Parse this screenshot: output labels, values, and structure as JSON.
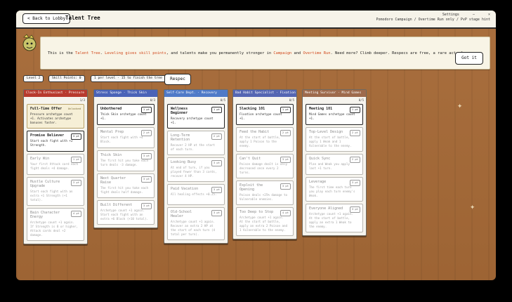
{
  "header": {
    "back_label": "< Back to Lobby",
    "title": "Talent Tree",
    "settings_label": "Settings",
    "minimize": "–",
    "close": "×",
    "breadcrumb": "Pomodoro Campaign / Overtime Run only / PvP stage hint"
  },
  "banner": {
    "p1": "This is the ",
    "h1": "Talent Tree",
    "p2": ". ",
    "h2": "Leveling gives skill points",
    "p3": ", and talents make you permanently stronger in ",
    "h3": "Campaign",
    "p4": " and ",
    "h4": "Overtime Run",
    "p5": ". Need more? Climb deeper. Respecs are free, a rare act of mercy.",
    "button": "Got it"
  },
  "stats": {
    "level": "Level 2",
    "points": "Skill Points: 0",
    "hint": "1 per level · 15 to finish the tree",
    "respec": "Respec"
  },
  "colors": {
    "col1": "#b83a2e",
    "col2": "#4a63b8",
    "col3": "#4f7ac8",
    "col4": "#5566b3",
    "col5": "#9e6a4c"
  },
  "columns": [
    {
      "title": "Clock-In Enthusiast · Pressure",
      "count": "1/3",
      "cards": [
        {
          "name": "Full-Time Offer",
          "desc": "Pressure archetype count +1. Activates archetype bonuses faster.",
          "tag": "Unlocked"
        },
        {
          "name": "Promise Believer",
          "desc": "Start each fight with +2 Strength.",
          "cost": "3 pt"
        },
        {
          "name": "Early Win",
          "desc": "Your first Attack card each fight deals +4 damage.",
          "cost": "1 pt"
        },
        {
          "name": "Hustle Culture Upgrade",
          "desc": "Start each fight with an extra +1 Strength (+1 total).",
          "cost": "3 pt"
        },
        {
          "name": "Bain Character Energy",
          "desc": "Archetype count +1 again. If Strength is 8 or higher, Attack cards deal +2 damage.",
          "cost": "4 pt"
        }
      ]
    },
    {
      "title": "Stress Sponge · Thick Skin",
      "count": "0/3",
      "cards": [
        {
          "name": "Unbothered",
          "desc": "Thick Skin archetype count +1.",
          "cost": "1 pt"
        },
        {
          "name": "Mental Prep",
          "desc": "Start each fight with +4 Block.",
          "cost": "2 pt"
        },
        {
          "name": "Thick Skin",
          "desc": "The first hit you take each turn deals -3 damage.",
          "cost": "3 pt"
        },
        {
          "name": "Next Quarter Raise",
          "desc": "The first hit you take each fight deals half damage.",
          "cost": "3 pt"
        },
        {
          "name": "Built Different",
          "desc": "Archetype count +1 again. Start each fight with an extra +6 Block (+10 total).",
          "cost": "3 pt"
        }
      ]
    },
    {
      "title": "Self-Care Dept. · Recovery",
      "count": "0/5",
      "cards": [
        {
          "name": "Wellness Beginner",
          "desc": "Recovery archetype count +1.",
          "cost": "1 pt"
        },
        {
          "name": "Long-Term Retention",
          "desc": "Recover 2 HP at the start of each turn.",
          "cost": "2 pt"
        },
        {
          "name": "Looking Busy",
          "desc": "At end of turn, if you played fewer than 3 cards, recover 4 HP.",
          "cost": "3 pt"
        },
        {
          "name": "Paid Vacation",
          "desc": "All healing effects +0.25.",
          "cost": "3 pt"
        },
        {
          "name": "Old-School Healer",
          "desc": "Archetype count +1 again. Recover an extra 2 HP at the start of each turn (4 total per turn).",
          "cost": "3 pt"
        }
      ]
    },
    {
      "title": "Bad Habit Specialist · Fixation",
      "count": "0/5",
      "cards": [
        {
          "name": "Slacking 101",
          "desc": "Fixation archetype count +1.",
          "cost": "1 pt"
        },
        {
          "name": "Feed the Habit",
          "desc": "At the start of battle, apply 1 Poison to the enemy.",
          "cost": "2 pt"
        },
        {
          "name": "Can't Quit",
          "desc": "Poison damage dealt is only decreased once every 2 turns.",
          "cost": "3 pt"
        },
        {
          "name": "Exploit the Opening",
          "desc": "Poison deals +25% damage to Vulnerable enemies.",
          "cost": "3 pt"
        },
        {
          "name": "Too Deep to Stop",
          "desc": "Archetype count +1 again. At the start of battle, apply an extra 2 Poison and 1 Vulnerable to the enemy.",
          "cost": "4 pt"
        }
      ]
    },
    {
      "title": "Meeting Survivor · Mind Games",
      "count": "0/5",
      "cards": [
        {
          "name": "Meeting 101",
          "desc": "Mind Games archetype count +1.",
          "cost": "1 pt"
        },
        {
          "name": "Top-Level Design",
          "desc": "At the start of battle, apply 1 Weak and 1 Vulnerable to the enemy.",
          "cost": "2 pt"
        },
        {
          "name": "Quick Sync",
          "desc": "Plan and Weak you apply last +1 turn.",
          "cost": "2 pt"
        },
        {
          "name": "Leverage",
          "desc": "The first time each turn you play each turn enemy's Weak.",
          "cost": "3 pt"
        },
        {
          "name": "Everyone Aligned",
          "desc": "Archetype count +1 again. At the start of battle, apply an extra 1 Weak to the enemy.",
          "cost": "3 pt"
        }
      ]
    }
  ]
}
